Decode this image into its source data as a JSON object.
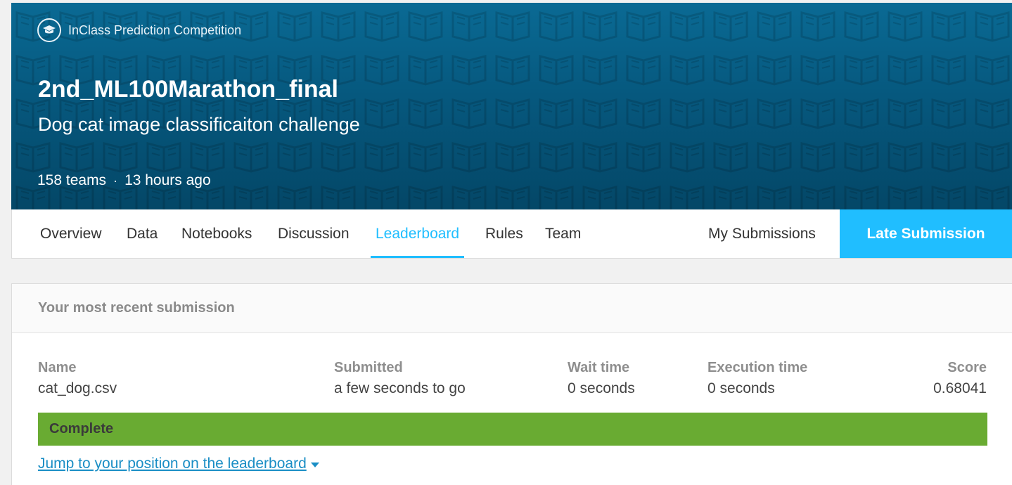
{
  "header": {
    "competition_type": "InClass Prediction Competition",
    "title": "2nd_ML100Marathon_final",
    "subtitle": "Dog cat image classificaiton challenge",
    "teams": "158 teams",
    "separator": "·",
    "time_ago": "13 hours ago"
  },
  "tabs": [
    {
      "label": "Overview"
    },
    {
      "label": "Data"
    },
    {
      "label": "Notebooks"
    },
    {
      "label": "Discussion"
    },
    {
      "label": "Leaderboard",
      "active": true
    },
    {
      "label": "Rules"
    },
    {
      "label": "Team"
    }
  ],
  "my_submissions_label": "My Submissions",
  "late_submission_label": "Late Submission",
  "submission": {
    "card_title": "Your most recent submission",
    "columns": {
      "name": {
        "header": "Name",
        "value": "cat_dog.csv"
      },
      "submitted": {
        "header": "Submitted",
        "value": "a few seconds to go"
      },
      "wait_time": {
        "header": "Wait time",
        "value": "0 seconds"
      },
      "execution_time": {
        "header": "Execution time",
        "value": "0 seconds"
      },
      "score": {
        "header": "Score",
        "value": "0.68041"
      }
    },
    "status": "Complete",
    "jump_link": "Jump to your position on the leaderboard"
  },
  "colors": {
    "accent": "#20beff",
    "banner": "#06587e",
    "complete": "#69ab32",
    "link": "#1a8ec5"
  }
}
